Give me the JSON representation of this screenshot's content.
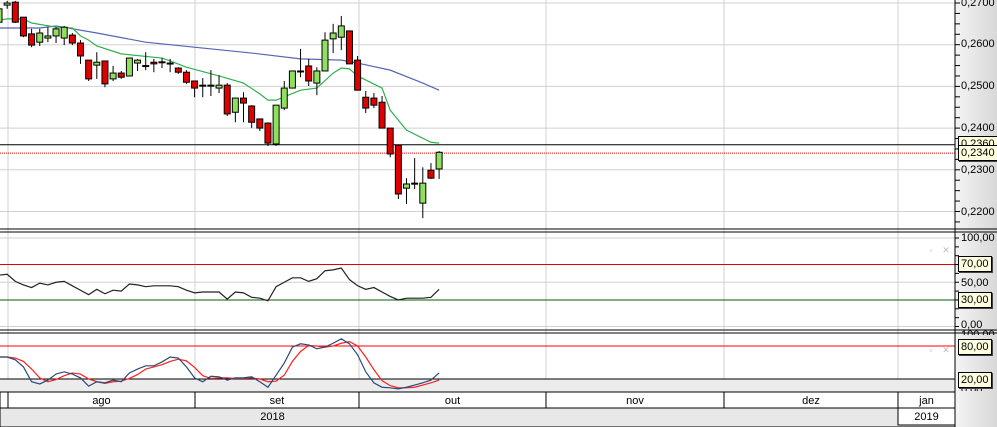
{
  "colors": {
    "up": "#90e060",
    "down": "#e00000",
    "ma_fast": "#30b050",
    "ma_slow": "#5565b5",
    "rsi": "#222222",
    "stoch_k": "#2a4a7a",
    "stoch_d": "#ff2020",
    "ref_line": "#000000",
    "last_price_line": "#ff0000",
    "rsi_upper": "#e00000",
    "rsi_lower": "#006000",
    "stoch_upper": "#ff0000",
    "stoch_lower": "#000000",
    "axis_bg": "#e4e4e4",
    "grid": "#d0d0d0"
  },
  "icons": {
    "panel_restore": "restore-icon",
    "panel_close": "close-icon"
  },
  "chart_data": [
    {
      "type": "candlestick",
      "ylim": [
        0.2165,
        0.2707
      ],
      "grid": true,
      "y_ticks": [
        "0,2700",
        "0,2600",
        "0,2500",
        "0,2400",
        "0,2300",
        "0,2200"
      ],
      "y_tick_values": [
        0.27,
        0.26,
        0.25,
        0.24,
        0.23,
        0.22
      ],
      "ohlc": [
        [
          0.2654,
          0.2695,
          0.2652,
          0.2686
        ],
        [
          0.2695,
          0.2705,
          0.2686,
          0.27
        ],
        [
          0.2702,
          0.2705,
          0.2652,
          0.2654
        ],
        [
          0.2666,
          0.2666,
          0.2618,
          0.2621
        ],
        [
          0.2626,
          0.2638,
          0.2594,
          0.2599
        ],
        [
          0.2606,
          0.2638,
          0.2597,
          0.2628
        ],
        [
          0.2616,
          0.2642,
          0.2606,
          0.2621
        ],
        [
          0.2621,
          0.2642,
          0.2604,
          0.2638
        ],
        [
          0.2616,
          0.2645,
          0.2599,
          0.2642
        ],
        [
          0.2623,
          0.2628,
          0.2599,
          0.2604
        ],
        [
          0.2604,
          0.2611,
          0.2554,
          0.2573
        ],
        [
          0.2563,
          0.2563,
          0.2513,
          0.2518
        ],
        [
          0.2551,
          0.2582,
          0.2518,
          0.2558
        ],
        [
          0.2561,
          0.2561,
          0.2498,
          0.2506
        ],
        [
          0.2518,
          0.2549,
          0.2513,
          0.2532
        ],
        [
          0.2532,
          0.2537,
          0.2518,
          0.2522
        ],
        [
          0.2525,
          0.2568,
          0.2525,
          0.2568
        ],
        [
          0.2556,
          0.2566,
          0.2537,
          0.2563
        ],
        [
          0.2549,
          0.2582,
          0.2539,
          0.255
        ],
        [
          0.2558,
          0.2566,
          0.2534,
          0.2554
        ],
        [
          0.2558,
          0.2568,
          0.2544,
          0.2559
        ],
        [
          0.2556,
          0.2566,
          0.2534,
          0.2555
        ],
        [
          0.2544,
          0.2546,
          0.253,
          0.2534
        ],
        [
          0.2534,
          0.2539,
          0.2506,
          0.251
        ],
        [
          0.2513,
          0.2513,
          0.2474,
          0.2496
        ],
        [
          0.2503,
          0.252,
          0.2474,
          0.2502
        ],
        [
          0.2503,
          0.2539,
          0.2477,
          0.2503
        ],
        [
          0.2496,
          0.2527,
          0.2484,
          0.2503
        ],
        [
          0.2503,
          0.2508,
          0.2429,
          0.2434
        ],
        [
          0.2438,
          0.2472,
          0.2414,
          0.2472
        ],
        [
          0.2472,
          0.2486,
          0.2414,
          0.246
        ],
        [
          0.2453,
          0.2455,
          0.24,
          0.2414
        ],
        [
          0.2422,
          0.2422,
          0.2393,
          0.24
        ],
        [
          0.2412,
          0.2414,
          0.2357,
          0.2364
        ],
        [
          0.2362,
          0.2455,
          0.2357,
          0.2455
        ],
        [
          0.2448,
          0.2513,
          0.2443,
          0.2496
        ],
        [
          0.2496,
          0.2537,
          0.2496,
          0.2537
        ],
        [
          0.2537,
          0.259,
          0.2522,
          0.2536
        ],
        [
          0.2549,
          0.2566,
          0.2501,
          0.2513
        ],
        [
          0.2508,
          0.2546,
          0.2479,
          0.2537
        ],
        [
          0.2537,
          0.263,
          0.2537,
          0.2611
        ],
        [
          0.2614,
          0.265,
          0.258,
          0.2628
        ],
        [
          0.2618,
          0.2669,
          0.2587,
          0.2645
        ],
        [
          0.2633,
          0.2633,
          0.2554,
          0.2554
        ],
        [
          0.2563,
          0.2573,
          0.2491,
          0.2491
        ],
        [
          0.2474,
          0.2489,
          0.2436,
          0.2448
        ],
        [
          0.2472,
          0.2484,
          0.2448,
          0.2455
        ],
        [
          0.2462,
          0.2477,
          0.24,
          0.24
        ],
        [
          0.24,
          0.24,
          0.233,
          0.2338
        ],
        [
          0.2359,
          0.2359,
          0.223,
          0.2242
        ],
        [
          0.2256,
          0.228,
          0.2218,
          0.2266
        ],
        [
          0.2268,
          0.2328,
          0.2254,
          0.2267
        ],
        [
          0.222,
          0.2306,
          0.2184,
          0.2268
        ],
        [
          0.2299,
          0.2316,
          0.2278,
          0.228
        ],
        [
          0.2302,
          0.2345,
          0.2278,
          0.2342
        ]
      ],
      "ma_fast": [
        [
          0,
          0.2659
        ],
        [
          1,
          0.2662
        ],
        [
          3,
          0.2662
        ],
        [
          4,
          0.2652
        ],
        [
          7,
          0.2642
        ],
        [
          9,
          0.264
        ],
        [
          10,
          0.2621
        ],
        [
          11,
          0.2611
        ],
        [
          12,
          0.2597
        ],
        [
          15,
          0.2578
        ],
        [
          20,
          0.2568
        ],
        [
          21,
          0.2561
        ],
        [
          23,
          0.2546
        ],
        [
          27,
          0.2525
        ],
        [
          30,
          0.2508
        ],
        [
          32,
          0.2482
        ],
        [
          33,
          0.2467
        ],
        [
          34,
          0.2467
        ],
        [
          37,
          0.2491
        ],
        [
          39,
          0.2496
        ],
        [
          41,
          0.2532
        ],
        [
          42,
          0.2544
        ],
        [
          43,
          0.2542
        ],
        [
          44,
          0.2525
        ],
        [
          47,
          0.2496
        ],
        [
          48,
          0.2443
        ],
        [
          50,
          0.2395
        ],
        [
          53,
          0.2366
        ],
        [
          54,
          0.2364
        ]
      ],
      "ma_slow": [
        [
          0,
          0.264
        ],
        [
          5,
          0.264
        ],
        [
          7,
          0.2645
        ],
        [
          12,
          0.2628
        ],
        [
          18,
          0.2606
        ],
        [
          25,
          0.2592
        ],
        [
          31,
          0.258
        ],
        [
          37,
          0.2566
        ],
        [
          42,
          0.2563
        ],
        [
          44,
          0.2556
        ],
        [
          48,
          0.2539
        ],
        [
          52,
          0.2508
        ],
        [
          54,
          0.2491
        ]
      ],
      "ref_line": {
        "value": 0.236,
        "label": "0,2360"
      },
      "last_price": {
        "value": 0.234,
        "label": "0,2340"
      }
    },
    {
      "type": "line",
      "ylim": [
        0,
        100
      ],
      "y_ticks": [
        "100,00",
        "50,00",
        "0,00"
      ],
      "y_tick_values": [
        100,
        50,
        0
      ],
      "levels": [
        {
          "value": 70,
          "label": "70,00"
        },
        {
          "value": 30,
          "label": "30,00"
        }
      ],
      "values": [
        58,
        59,
        51,
        47,
        44,
        49,
        47,
        50,
        51,
        46,
        41,
        36,
        42,
        37,
        41,
        40,
        48,
        47,
        45,
        46,
        46,
        46,
        45,
        41,
        38,
        39,
        39,
        39,
        31,
        39,
        38,
        33,
        32,
        29,
        45,
        50,
        55,
        55,
        51,
        54,
        63,
        64,
        66,
        53,
        46,
        42,
        44,
        39,
        34,
        30,
        32,
        32,
        32,
        33,
        42
      ]
    },
    {
      "type": "line",
      "ylim": [
        0,
        100
      ],
      "y_ticks": [
        "100,00",
        "0,00"
      ],
      "y_tick_values": [
        100,
        0
      ],
      "levels": [
        {
          "value": 80,
          "label": "80,00"
        },
        {
          "value": 20,
          "label": "20,00"
        }
      ],
      "series": [
        {
          "values": [
            60,
            60,
            55,
            42,
            15,
            11,
            18,
            29,
            33,
            29,
            22,
            7,
            15,
            13,
            18,
            15,
            31,
            38,
            44,
            44,
            51,
            60,
            58,
            42,
            22,
            15,
            25,
            24,
            18,
            22,
            22,
            24,
            15,
            5,
            27,
            49,
            78,
            84,
            82,
            75,
            78,
            85,
            93,
            84,
            64,
            33,
            13,
            5,
            4,
            2,
            5,
            9,
            13,
            18,
            31
          ]
        },
        {
          "values": [
            60,
            60,
            58,
            52,
            38,
            22,
            15,
            19,
            26,
            31,
            29,
            20,
            15,
            12,
            15,
            16,
            21,
            28,
            38,
            42,
            46,
            52,
            56,
            53,
            41,
            26,
            21,
            22,
            22,
            21,
            21,
            22,
            20,
            15,
            16,
            27,
            52,
            70,
            81,
            80,
            78,
            80,
            85,
            88,
            80,
            60,
            37,
            17,
            8,
            4,
            4,
            5,
            9,
            13,
            18
          ]
        }
      ]
    }
  ],
  "x_axis": {
    "months": [
      "ago",
      "set",
      "out",
      "nov",
      "dez",
      "jan"
    ],
    "years": [
      "2018",
      "2019"
    ]
  }
}
